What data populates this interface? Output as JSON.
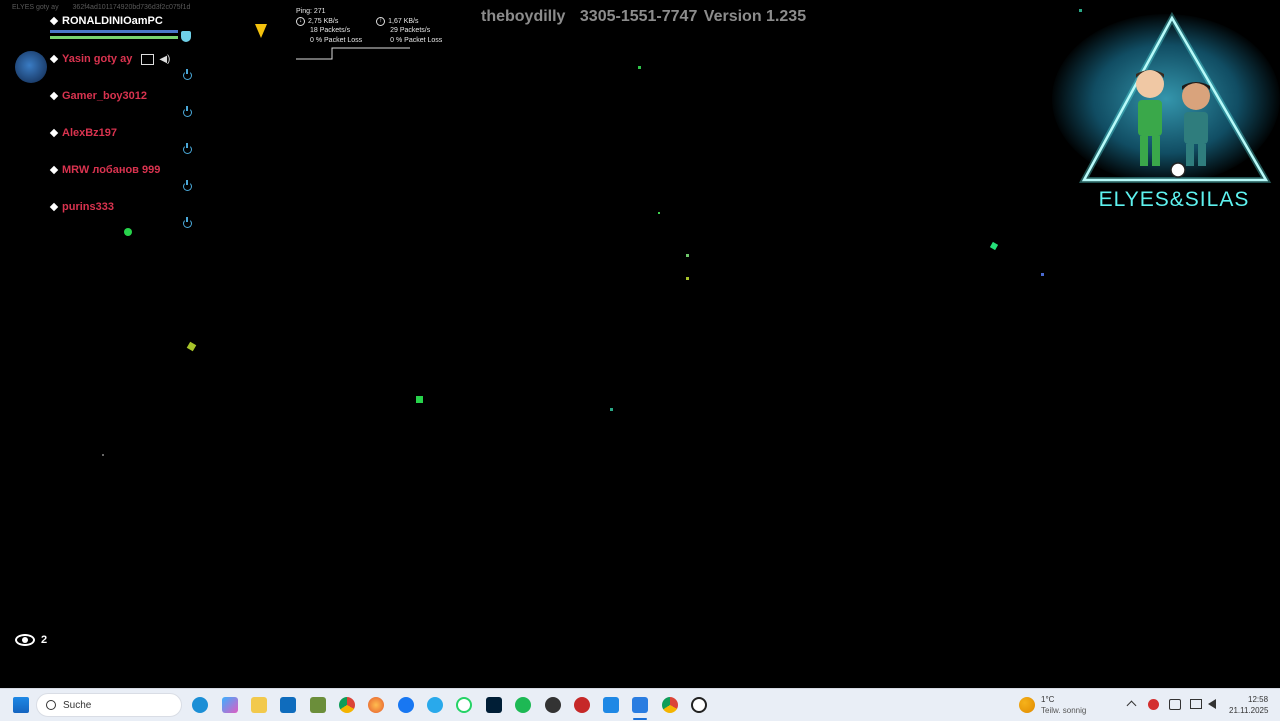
{
  "session": {
    "name": "ELYES goty ay",
    "id": "362f4ad101174920bd736d3f2c075f1d"
  },
  "squad": {
    "leader": "RONALDINIOamPC",
    "members": [
      {
        "name": "Yasin goty ay"
      },
      {
        "name": "Gamer_boy3012"
      },
      {
        "name": "AlexBz197"
      },
      {
        "name": "MRW лобанов 999"
      },
      {
        "name": "purins333"
      }
    ]
  },
  "network": {
    "ping": "Ping: 271",
    "down": {
      "rate": "2,75 KB/s",
      "packets": "18 Packets/s",
      "loss": "0 % Packet Loss"
    },
    "up": {
      "rate": "1,67 KB/s",
      "packets": "29 Packets/s",
      "loss": "0 % Packet Loss"
    }
  },
  "header": {
    "user": "theboydilly",
    "code": "3305-1551-7747",
    "version": "Version 1.235"
  },
  "logo": {
    "text": "ELYES&SILAS"
  },
  "spectators": {
    "count": "2"
  },
  "taskbar": {
    "search_placeholder": "Suche",
    "weather_temp": "1°C",
    "weather_desc": "Teilw. sonnig",
    "time": "12:58",
    "date": "21.11.2025"
  },
  "colors": {
    "accent": "#5ef2ef",
    "player_name": "#d9334f",
    "taskbar": "#e9eef6"
  }
}
